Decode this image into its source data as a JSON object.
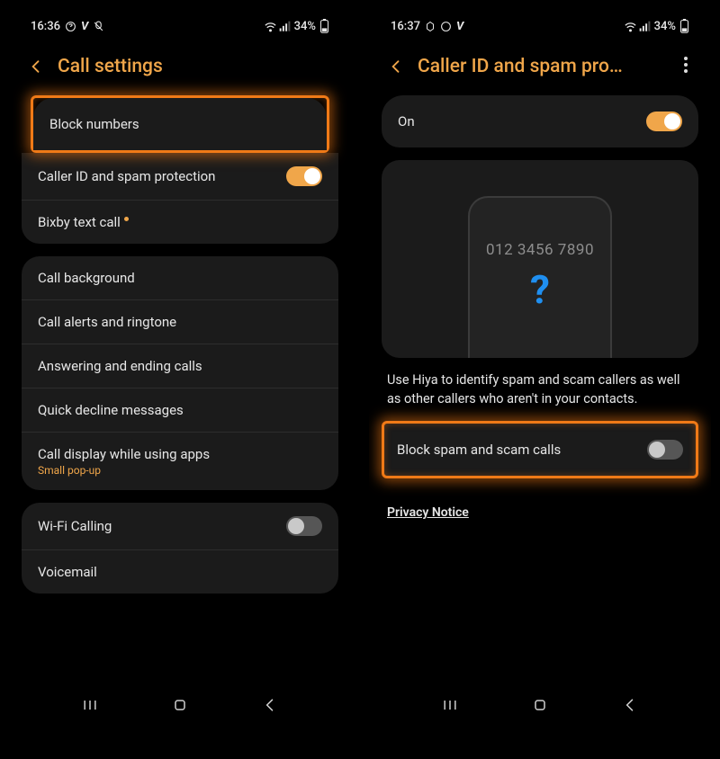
{
  "left": {
    "status": {
      "time": "16:36",
      "battery": "34%"
    },
    "header": {
      "title": "Call settings"
    },
    "group1": {
      "item0": {
        "label": "Block numbers"
      },
      "item1": {
        "label": "Caller ID and spam protection",
        "toggle_on": true
      },
      "item2": {
        "label": "Bixby text call"
      }
    },
    "group2": {
      "item0": {
        "label": "Call background"
      },
      "item1": {
        "label": "Call alerts and ringtone"
      },
      "item2": {
        "label": "Answering and ending calls"
      },
      "item3": {
        "label": "Quick decline messages"
      },
      "item4": {
        "label": "Call display while using apps",
        "sub": "Small pop-up"
      }
    },
    "group3": {
      "item0": {
        "label": "Wi-Fi Calling",
        "toggle_on": false
      },
      "item1": {
        "label": "Voicemail"
      }
    }
  },
  "right": {
    "status": {
      "time": "16:37",
      "battery": "34%"
    },
    "header": {
      "title": "Caller ID and spam pro…"
    },
    "master": {
      "label": "On",
      "toggle_on": true
    },
    "illustration": {
      "number": "012 3456 7890",
      "symbol": "?"
    },
    "description": "Use Hiya to identify spam and scam callers as well as other callers who aren't in your contacts.",
    "block_row": {
      "label": "Block spam and scam calls",
      "toggle_on": false
    },
    "privacy": "Privacy Notice"
  }
}
